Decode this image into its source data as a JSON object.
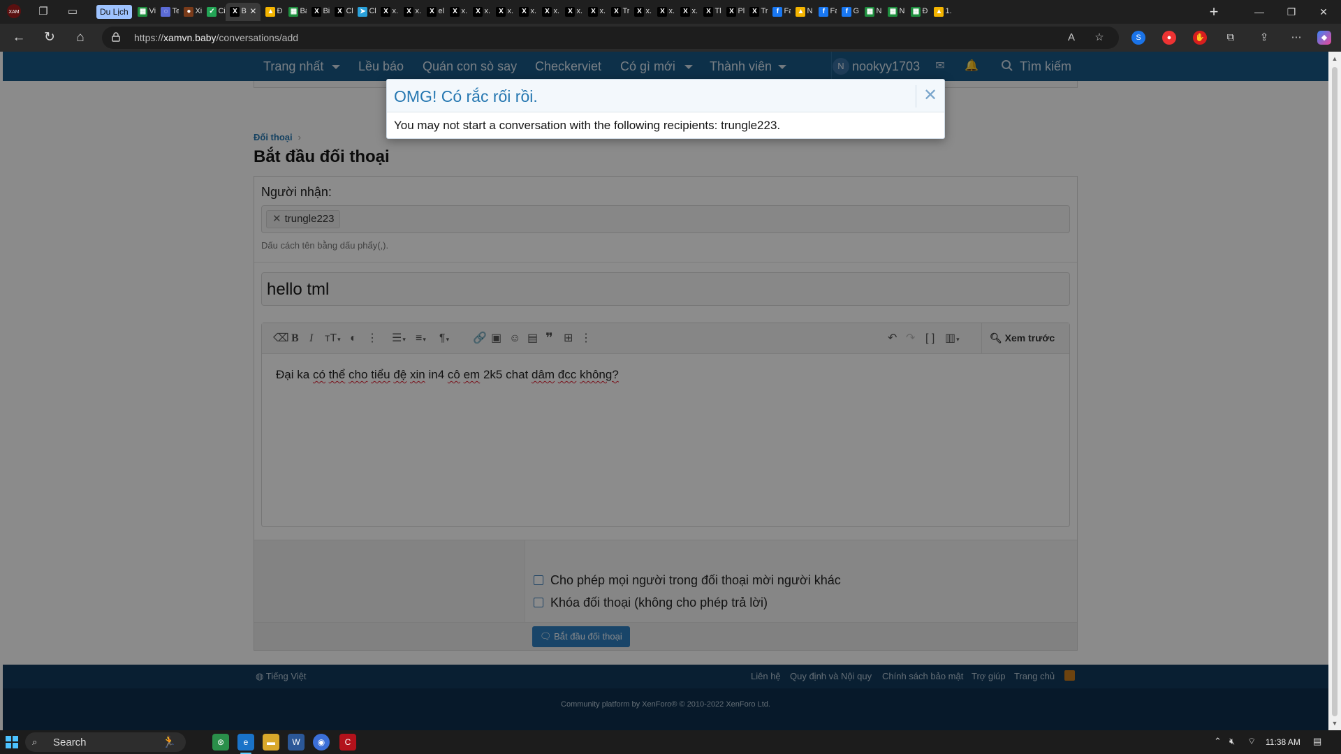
{
  "browser": {
    "group_label": "Du Lịch",
    "tabs": [
      {
        "icon": "sheets-icon",
        "label": "Vi",
        "color": "#1e8e3e"
      },
      {
        "icon": "loading-icon",
        "label": "Te",
        "color": "#5b6bd6"
      },
      {
        "icon": "dark-icon",
        "label": "Xi",
        "color": "#7a3b1a"
      },
      {
        "icon": "check-icon",
        "label": "Ci",
        "color": "#23a455"
      },
      {
        "icon": "x-icon",
        "label": "B",
        "color": "#000000"
      },
      {
        "icon": "drive-icon",
        "label": "Đ",
        "color": "#f4b400"
      },
      {
        "icon": "sheets-icon",
        "label": "Bả",
        "color": "#1e8e3e"
      },
      {
        "icon": "x-icon",
        "label": "Bi",
        "color": "#000000"
      },
      {
        "icon": "x-icon",
        "label": "Cl",
        "color": "#000000"
      },
      {
        "icon": "telegram-icon",
        "label": "Cl",
        "color": "#2aa1da"
      },
      {
        "icon": "x-icon",
        "label": "x.",
        "color": "#000000"
      },
      {
        "icon": "x-icon",
        "label": "x.",
        "color": "#000000"
      },
      {
        "icon": "x-icon",
        "label": "el",
        "color": "#000000"
      },
      {
        "icon": "x-icon",
        "label": "x.",
        "color": "#000000"
      },
      {
        "icon": "x-icon",
        "label": "x.",
        "color": "#000000"
      },
      {
        "icon": "x-icon",
        "label": "x.",
        "color": "#000000"
      },
      {
        "icon": "x-icon",
        "label": "x.",
        "color": "#000000"
      },
      {
        "icon": "x-icon",
        "label": "x.",
        "color": "#000000"
      },
      {
        "icon": "x-icon",
        "label": "x.",
        "color": "#000000"
      },
      {
        "icon": "x-icon",
        "label": "x.",
        "color": "#000000"
      },
      {
        "icon": "x-icon",
        "label": "Tr",
        "color": "#000000"
      },
      {
        "icon": "x-icon",
        "label": "x.",
        "color": "#000000"
      },
      {
        "icon": "x-icon",
        "label": "x.",
        "color": "#000000"
      },
      {
        "icon": "x-icon",
        "label": "x.",
        "color": "#000000"
      },
      {
        "icon": "x-icon",
        "label": "Tl",
        "color": "#000000"
      },
      {
        "icon": "x-icon",
        "label": "Pl",
        "color": "#000000"
      },
      {
        "icon": "x-icon",
        "label": "Tr",
        "color": "#000000"
      },
      {
        "icon": "facebook-icon",
        "label": "Fa",
        "color": "#1877f2"
      },
      {
        "icon": "drive-icon",
        "label": "N",
        "color": "#f4b400"
      },
      {
        "icon": "facebook-icon",
        "label": "Fa",
        "color": "#1877f2"
      },
      {
        "icon": "facebook-icon",
        "label": "G",
        "color": "#1877f2"
      },
      {
        "icon": "sheets-icon",
        "label": "N",
        "color": "#1e8e3e"
      },
      {
        "icon": "sheets-icon",
        "label": "N",
        "color": "#1e8e3e"
      },
      {
        "icon": "sheets-icon",
        "label": "Đ",
        "color": "#1e8e3e"
      },
      {
        "icon": "drive-icon",
        "label": "1.",
        "color": "#f4b400"
      }
    ],
    "active_tab_label": "B",
    "url_prefix": "https://",
    "url_host": "xamvn.baby",
    "url_path": "/conversations/add"
  },
  "site_nav": {
    "items": [
      "Trang nhất",
      "Lều báo",
      "Quán con sò say",
      "Checkerviet",
      "Có gì mới",
      "Thành viên"
    ],
    "avatar_letter": "N",
    "username": "nookyy1703",
    "search_label": "Tìm kiếm",
    "color": "#185886"
  },
  "breadcrumb": {
    "label": "Đối thoại"
  },
  "page_title": "Bắt đầu đối thoại",
  "form": {
    "recipients_label": "Người nhận:",
    "recipient_token": "trungle223",
    "recipients_hint": "Dấu cách tên bằng dấu phẩy(,).",
    "subject_value": "hello tml",
    "preview_label": "Xem trước",
    "message_words": [
      "Đại",
      "ka",
      "có",
      "thể",
      "cho",
      "tiểu",
      "đệ",
      "xin",
      "in4",
      "cô",
      "em",
      "2k5",
      "chat",
      "dâm",
      "đcc",
      "không?"
    ],
    "message_misspelled": [
      false,
      false,
      true,
      true,
      true,
      true,
      true,
      true,
      false,
      true,
      true,
      false,
      false,
      true,
      true,
      true
    ],
    "option_invite": "Cho phép mọi người trong đối thoại mời người khác",
    "option_lock": "Khóa đối thoại (không cho phép trả lời)",
    "submit_label": "Bắt đầu đối thoại",
    "accent_color": "#2f7ec0"
  },
  "footer": {
    "language": "Tiếng Việt",
    "links": [
      "Liên hệ",
      "Quy định và Nội quy",
      "Chính sách bảo mật",
      "Trợ giúp",
      "Trang chủ"
    ],
    "copyright": "Community platform by XenForo® © 2010-2022 XenForo Ltd."
  },
  "modal": {
    "title": "OMG! Có rắc rối rồi.",
    "message": "You may not start a conversation with the following recipients: trungle223.",
    "title_color": "#2577b1"
  },
  "taskbar": {
    "search_label": "Search",
    "time": "11:38 AM"
  }
}
